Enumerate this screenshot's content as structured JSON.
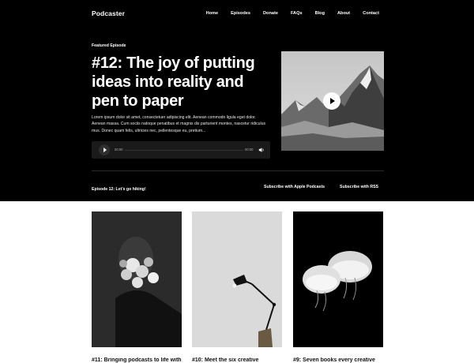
{
  "brand": "Podcaster",
  "nav": [
    "Home",
    "Episodes",
    "Donate",
    "FAQs",
    "Blog",
    "About",
    "Contact"
  ],
  "featured": {
    "eyebrow": "Featured Episode",
    "title": "#12: The joy of putting ideas into reality and pen to paper",
    "excerpt": "Lorem ipsum dolor sit amet, consectetuer adipiscing elit. Aenean commodo ligula eget dolor. Aenean massa. Cum sociis natoque penatibus et magnis dis parturient montes, nascetur ridiculus mus. Donec quam felis, ultricies nec, pellentesque eu, pretium...",
    "player": {
      "current_time": "00:00",
      "duration": "00:00",
      "progress": 0
    }
  },
  "latest_label": "Episode 12: Let’s go hiking!",
  "subscribe": {
    "apple": "Subscribe with Apple Podcasts",
    "rss": "Subscribe with RSS"
  },
  "cards": [
    {
      "title": "#11: Bringing podcasts to life with",
      "image": "woman-with-flowers-photo"
    },
    {
      "title": "#10: Meet the six creative",
      "image": "desk-lamp-photo"
    },
    {
      "title": "#9: Seven books every creative",
      "image": "jellyfish-photo"
    }
  ],
  "icons": {
    "play": "play-icon",
    "volume": "volume-icon"
  },
  "colors": {
    "hero_bg": "#000000",
    "page_bg": "#ffffff",
    "player_bg": "#1a1a1a"
  }
}
